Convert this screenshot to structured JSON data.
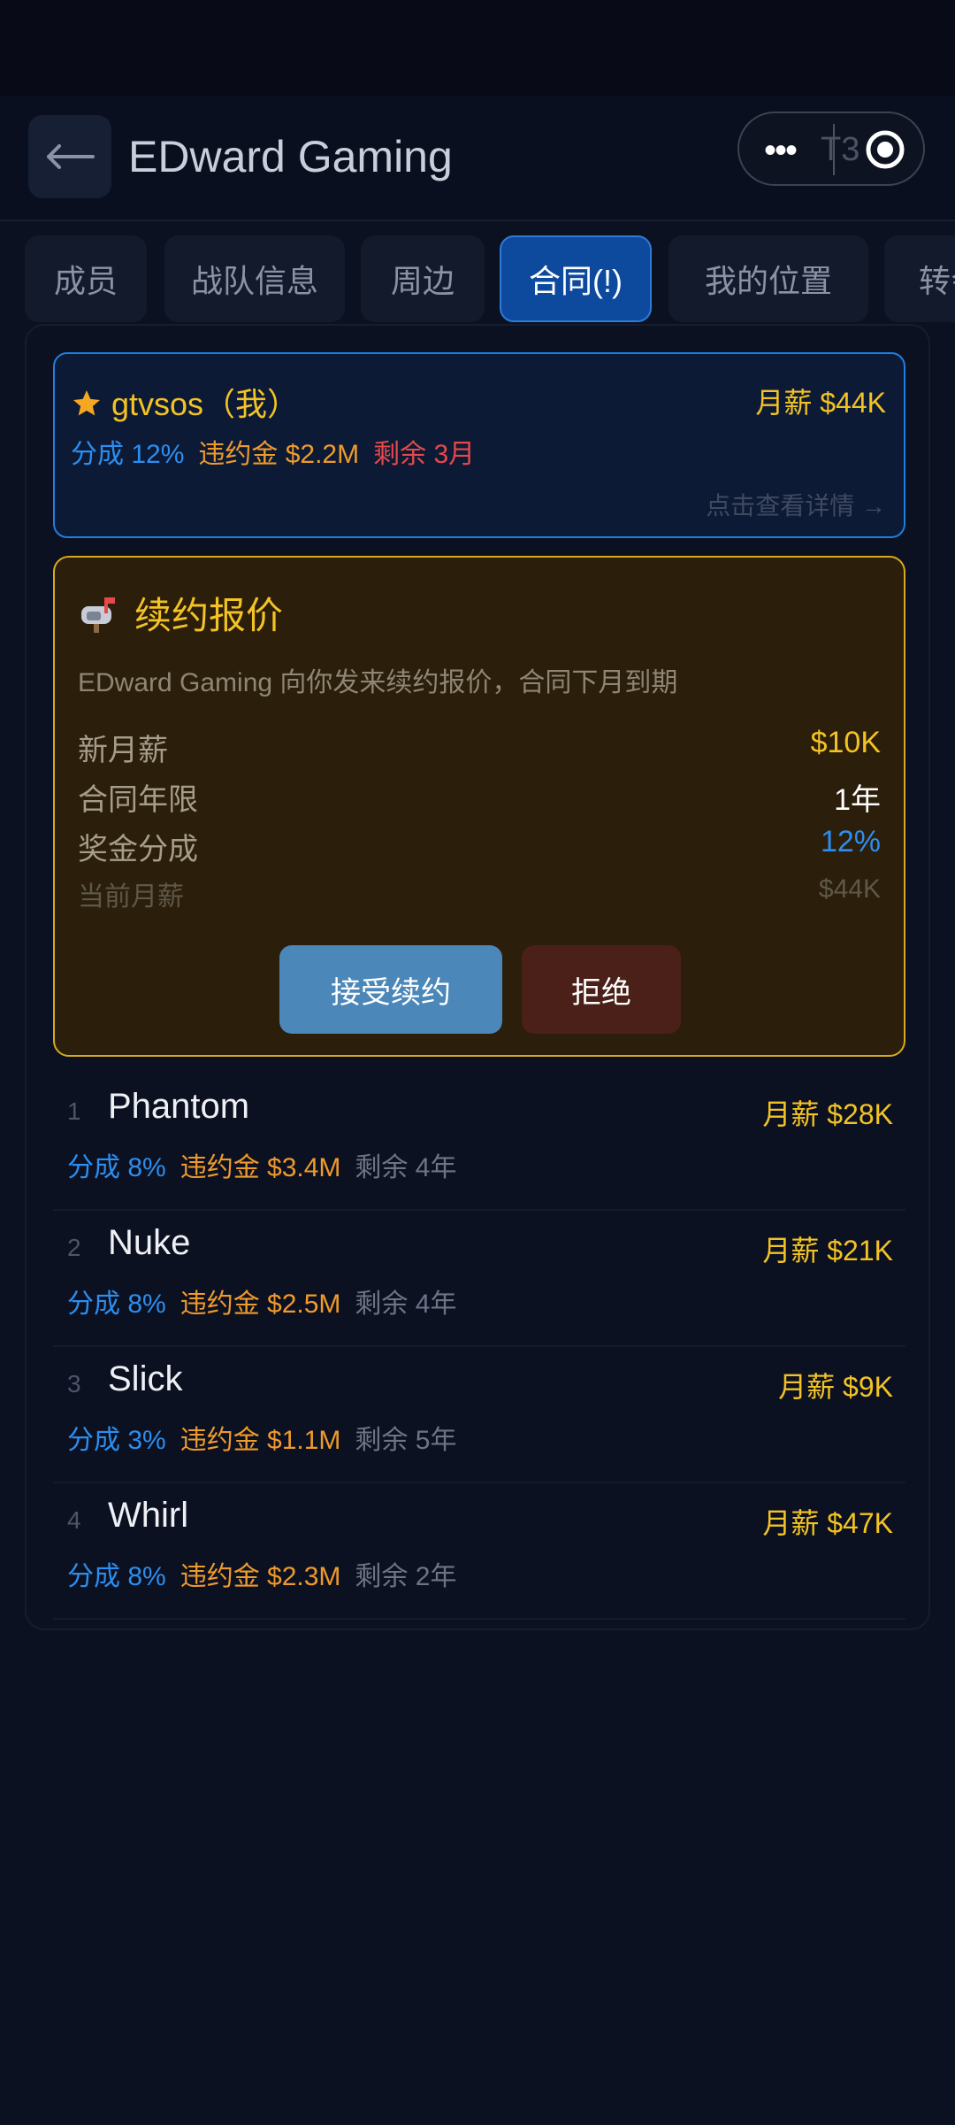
{
  "header": {
    "title": "EDward Gaming",
    "capsule_text": "T3"
  },
  "tabs": [
    {
      "label": "成员"
    },
    {
      "label": "战队信息"
    },
    {
      "label": "周边"
    },
    {
      "label": "合同(!)"
    },
    {
      "label": "我的位置"
    },
    {
      "label": "转会"
    }
  ],
  "active_tab": "合同(!)",
  "self_contract": {
    "name": "gtvsos（我）",
    "salary": "月薪 $44K",
    "share": "分成 12%",
    "penalty": "违约金 $2.2M",
    "remaining": "剩余 3月",
    "detail_link": "点击查看详情 →"
  },
  "renewal_offer": {
    "title": "续约报价",
    "description": "EDward Gaming 向你发来续约报价，合同下月到期",
    "rows": [
      {
        "label": "新月薪",
        "value": "$10K"
      },
      {
        "label": "合同年限",
        "value": "1年"
      },
      {
        "label": "奖金分成",
        "value": "12%"
      },
      {
        "label": "当前月薪",
        "value": "$44K"
      }
    ],
    "accept_label": "接受续约",
    "reject_label": "拒绝"
  },
  "players": [
    {
      "num": "1",
      "name": "Phantom",
      "salary": "月薪 $28K",
      "share": "分成 8%",
      "penalty": "违约金 $3.4M",
      "remaining": "剩余 4年"
    },
    {
      "num": "2",
      "name": "Nuke",
      "salary": "月薪 $21K",
      "share": "分成 8%",
      "penalty": "违约金 $2.5M",
      "remaining": "剩余 4年"
    },
    {
      "num": "3",
      "name": "Slick",
      "salary": "月薪 $9K",
      "share": "分成 3%",
      "penalty": "违约金 $1.1M",
      "remaining": "剩余 5年"
    },
    {
      "num": "4",
      "name": "Whirl",
      "salary": "月薪 $47K",
      "share": "分成 8%",
      "penalty": "违约金 $2.3M",
      "remaining": "剩余 2年"
    }
  ],
  "colors": {
    "accent_gold": "#f3c324",
    "accent_blue": "#2c8ef0",
    "accent_orange": "#ef9a2c",
    "accent_red": "#e5494b",
    "tab_active": "#0d4a9e",
    "accept_button": "#4b87b8",
    "reject_button": "#4a2018"
  },
  "icons": {
    "back": "arrow-left-icon",
    "more": "more-dots-icon",
    "close_target": "target-icon",
    "favorite": "star-icon",
    "mailbox": "mailbox-icon"
  }
}
